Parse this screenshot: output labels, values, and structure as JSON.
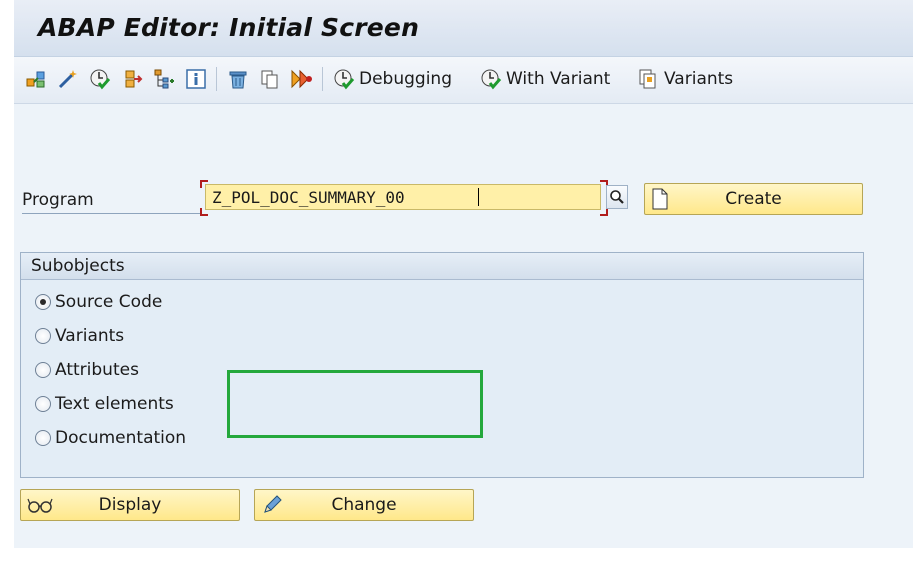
{
  "window": {
    "title": "ABAP Editor: Initial Screen"
  },
  "toolbar": {
    "icons": [
      "object-list-icon",
      "magic-wand-icon",
      "check-icon",
      "where-used-icon",
      "hierarchy-icon",
      "info-icon",
      "delete-icon",
      "copy-icon",
      "rename-icon"
    ],
    "debugging_label": "Debugging",
    "with_variant_label": "With Variant",
    "variants_label": "Variants"
  },
  "program": {
    "label": "Program",
    "value": "Z_POL_DOC_SUMMARY_00"
  },
  "buttons": {
    "create_label": "Create",
    "display_label": "Display",
    "change_label": "Change"
  },
  "subobjects": {
    "title": "Subobjects",
    "options": [
      {
        "label": "Source Code",
        "selected": true
      },
      {
        "label": "Variants",
        "selected": false
      },
      {
        "label": "Attributes",
        "selected": false
      },
      {
        "label": "Text elements",
        "selected": false
      },
      {
        "label": "Documentation",
        "selected": false
      }
    ]
  },
  "colors": {
    "input_bg": "#fff0a8",
    "button_bg": "#ffe88a",
    "highlight": "#24a83c",
    "required_marker": "#b11d1d"
  }
}
